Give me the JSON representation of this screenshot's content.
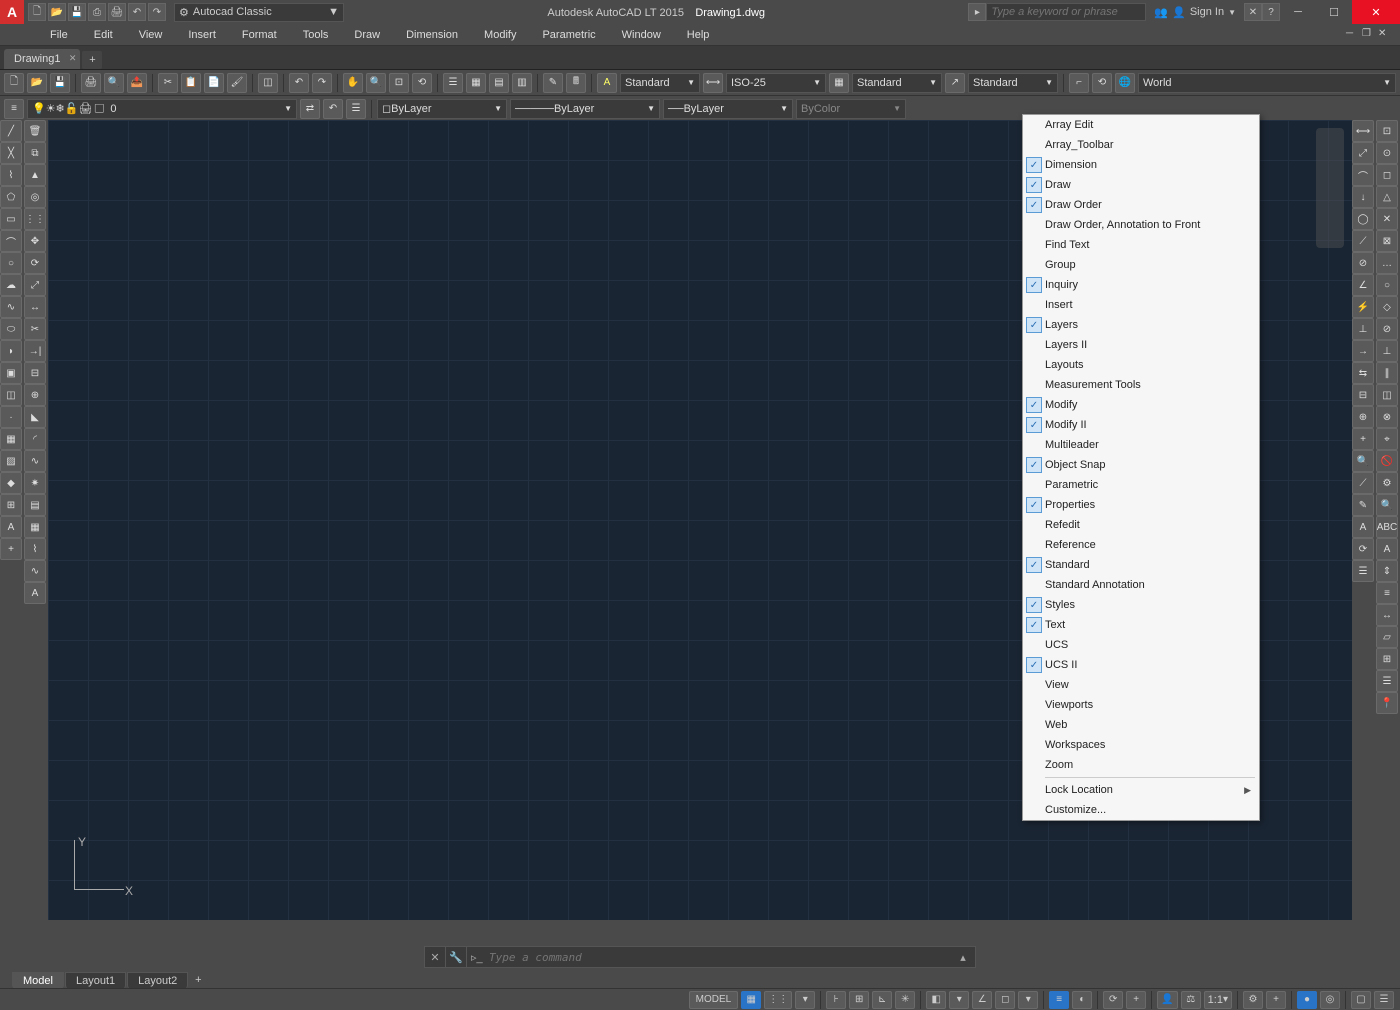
{
  "titlebar": {
    "app_name": "Autodesk AutoCAD LT 2015",
    "doc_name": "Drawing1.dwg",
    "workspace_label": "Autocad Classic",
    "search_placeholder": "Type a keyword or phrase",
    "signin_label": "Sign In"
  },
  "menubar": [
    "File",
    "Edit",
    "View",
    "Insert",
    "Format",
    "Tools",
    "Draw",
    "Dimension",
    "Modify",
    "Parametric",
    "Window",
    "Help"
  ],
  "doc_tab": "Drawing1",
  "toolbar2": {
    "text_style": "Standard",
    "dim_style": "ISO-25",
    "table_style": "Standard",
    "ml_style": "Standard",
    "ucs": "World"
  },
  "toolbar3": {
    "layer": "0",
    "linetype_combo1": "ByLayer",
    "linetype_combo2": "ByLayer",
    "linetype_combo3": "ByLayer",
    "plot_style": "ByColor"
  },
  "context_menu": [
    {
      "label": "Array Edit",
      "checked": false
    },
    {
      "label": "Array_Toolbar",
      "checked": false
    },
    {
      "label": "Dimension",
      "checked": true
    },
    {
      "label": "Draw",
      "checked": true
    },
    {
      "label": "Draw Order",
      "checked": true
    },
    {
      "label": "Draw Order, Annotation to Front",
      "checked": false
    },
    {
      "label": "Find Text",
      "checked": false
    },
    {
      "label": "Group",
      "checked": false
    },
    {
      "label": "Inquiry",
      "checked": true
    },
    {
      "label": "Insert",
      "checked": false
    },
    {
      "label": "Layers",
      "checked": true
    },
    {
      "label": "Layers II",
      "checked": false
    },
    {
      "label": "Layouts",
      "checked": false
    },
    {
      "label": "Measurement Tools",
      "checked": false
    },
    {
      "label": "Modify",
      "checked": true
    },
    {
      "label": "Modify II",
      "checked": true
    },
    {
      "label": "Multileader",
      "checked": false
    },
    {
      "label": "Object Snap",
      "checked": true
    },
    {
      "label": "Parametric",
      "checked": false
    },
    {
      "label": "Properties",
      "checked": true
    },
    {
      "label": "Refedit",
      "checked": false
    },
    {
      "label": "Reference",
      "checked": false
    },
    {
      "label": "Standard",
      "checked": true
    },
    {
      "label": "Standard Annotation",
      "checked": false
    },
    {
      "label": "Styles",
      "checked": true
    },
    {
      "label": "Text",
      "checked": true
    },
    {
      "label": "UCS",
      "checked": false
    },
    {
      "label": "UCS II",
      "checked": true
    },
    {
      "label": "View",
      "checked": false
    },
    {
      "label": "Viewports",
      "checked": false
    },
    {
      "label": "Web",
      "checked": false
    },
    {
      "label": "Workspaces",
      "checked": false
    },
    {
      "label": "Zoom",
      "checked": false
    }
  ],
  "context_menu_footer": {
    "lock_location": "Lock Location",
    "customize": "Customize..."
  },
  "cmdline_placeholder": "Type a command",
  "layout_tabs": [
    "Model",
    "Layout1",
    "Layout2"
  ],
  "statusbar": {
    "model": "MODEL",
    "scale": "1:1"
  },
  "ucs": {
    "x": "X",
    "y": "Y"
  }
}
